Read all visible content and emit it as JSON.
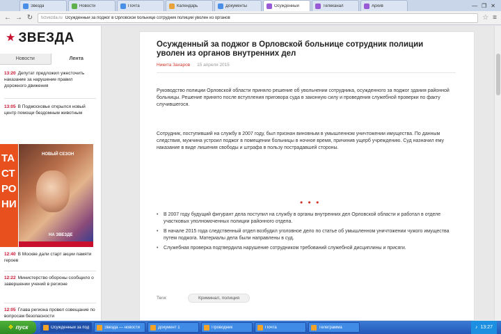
{
  "browser": {
    "tabs": [
      {
        "title": "Звезда",
        "color": "#4a8fe7",
        "active": false
      },
      {
        "title": "Новости",
        "color": "#5db04a",
        "active": false
      },
      {
        "title": "Почта",
        "color": "#4a8fe7",
        "active": false
      },
      {
        "title": "Календарь",
        "color": "#e8a33a",
        "active": false
      },
      {
        "title": "Документы",
        "color": "#4a8fe7",
        "active": false
      },
      {
        "title": "Осужденный",
        "color": "#9a5ad6",
        "active": true
      },
      {
        "title": "Телеканал",
        "color": "#9a5ad6",
        "active": false
      },
      {
        "title": "Архив",
        "color": "#9a5ad6",
        "active": false
      }
    ],
    "window_controls": [
      "—",
      "❐",
      "✕"
    ],
    "address": {
      "domain": "tvzvezda.ru",
      "path": "Осужденный за поджог в Орловской больнице сотрудник полиции уволен из органов"
    }
  },
  "site": {
    "logo_text": "ЗВЕЗДА",
    "tabs": [
      "Новости",
      "Лента"
    ],
    "news": [
      {
        "time": "13:20",
        "text": "Депутат предложил ужесточить наказание за нарушение правил дорожного движения"
      },
      {
        "time": "13:05",
        "text": "В Подмосковье открылся новый центр помощи бездомным животным"
      },
      {
        "time": "12:40",
        "text": "В Москве дали старт акции памяти героев"
      },
      {
        "time": "12:22",
        "text": "Министерство обороны сообщило о завершении учений в регионе"
      },
      {
        "time": "12:05",
        "text": "Глава региона провел совещание по вопросам безопасности"
      }
    ],
    "ad": {
      "letters": [
        "ТА",
        "СТ",
        "РО",
        "НИ"
      ],
      "caption": "НОВЫЙ СЕЗОН",
      "bottom_text": "НА ЗВЕЗДЕ"
    }
  },
  "article": {
    "headline": "Осужденный за поджог в Орловской больнице сотрудник полиции уволен из органов внутренних дел",
    "author": "Никита Захаров",
    "date": "15 апреля 2015",
    "paragraphs": [
      "Руководство полиции Орловской области приняло решение об увольнении сотрудника, осужденного за поджог здания районной больницы. Решение принято после вступления приговора суда в законную силу и проведения служебной проверки по факту случившегося.",
      "Сотрудник, поступивший на службу в 2007 году, был признан виновным в умышленном уничтожении имущества. По данным следствия, мужчина устроил поджог в помещении больницы в ночное время, причинив ущерб учреждению. Суд назначил ему наказание в виде лишения свободы и штрафа в пользу пострадавшей стороны."
    ],
    "dots": "• • •",
    "bullets": [
      "В 2007 году будущий фигурант дела поступил на службу в органы внутренних дел Орловской области и работал в отделе участковых уполномоченных полиции районного отдела.",
      "В начале 2015 года следственный отдел возбудил уголовное дело по статье об умышленном уничтожении чужого имущества путем поджога. Материалы дела были направлены в суд.",
      "Служебная проверка подтвердила нарушение сотрудником требований служебной дисциплины и присяги."
    ],
    "tags_label": "Теги:",
    "tags": [
      "Криминал, полиция"
    ]
  },
  "taskbar": {
    "start_label": "пуск",
    "items": [
      {
        "label": "Осужденный за поджог",
        "active": true
      },
      {
        "label": "Звезда — новости",
        "active": false
      },
      {
        "label": "Документ 1",
        "active": false
      },
      {
        "label": "Проводник",
        "active": false
      },
      {
        "label": "Почта",
        "active": false
      },
      {
        "label": "Телеграмма",
        "active": false
      }
    ],
    "clock": "13:27"
  }
}
